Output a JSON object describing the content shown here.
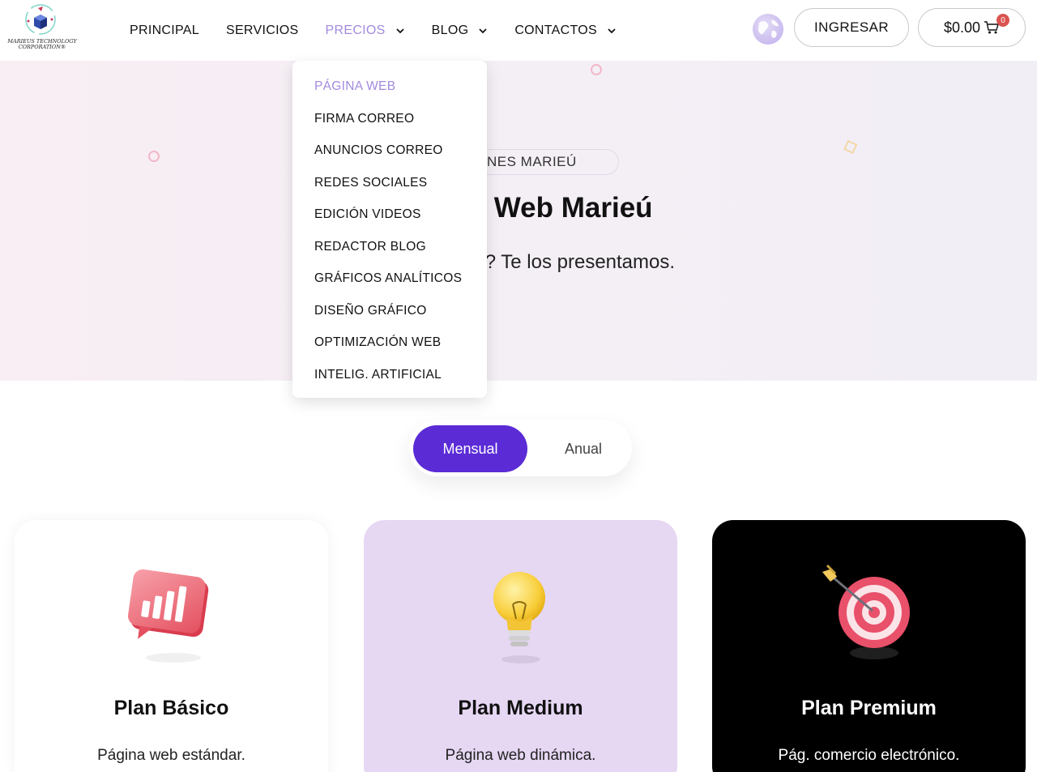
{
  "brand": {
    "logo_text": "MARIEUS TECHNOLOGY CORPORATION®"
  },
  "nav": {
    "items": [
      {
        "label": "PRINCIPAL",
        "has_dropdown": false
      },
      {
        "label": "SERVICIOS",
        "has_dropdown": false
      },
      {
        "label": "PRECIOS",
        "has_dropdown": true,
        "active": true
      },
      {
        "label": "BLOG",
        "has_dropdown": true
      },
      {
        "label": "CONTACTOS",
        "has_dropdown": true
      }
    ],
    "globe_icon": "globe-icon",
    "login_label": "INGRESAR",
    "cart_total": "$0.00",
    "cart_count": "0"
  },
  "dropdown": {
    "items": [
      "PÁGINA WEB",
      "FIRMA CORREO",
      "ANUNCIOS CORREO",
      "REDES SOCIALES",
      "EDICIÓN VIDEOS",
      "REDACTOR BLOG",
      "GRÁFICOS ANALÍTICOS",
      "DISEÑO GRÁFICO",
      "OPTIMIZACIÓN WEB",
      "INTELIG. ARTIFICIAL"
    ],
    "active_index": 0
  },
  "hero": {
    "pill": "NES MARIEÚ",
    "title": "inas Web Marieú",
    "subtitle": "emos? Te los presentamos."
  },
  "billing_toggle": {
    "selected": "Mensual",
    "other": "Anual"
  },
  "plans": [
    {
      "title": "Plan Básico",
      "description": "Página web estándar.",
      "icon": "bar-chart-icon"
    },
    {
      "title": "Plan Medium",
      "description": "Página web dinámica.",
      "icon": "lightbulb-icon"
    },
    {
      "title": "Plan Premium",
      "description": "Pág. comercio electrónico.",
      "icon": "target-icon"
    }
  ],
  "colors": {
    "accent": "#5b2bd6",
    "nav_active": "#a38adf",
    "medium_card": "#e6d7f3",
    "premium_card": "#000000",
    "badge": "#d9534f"
  }
}
